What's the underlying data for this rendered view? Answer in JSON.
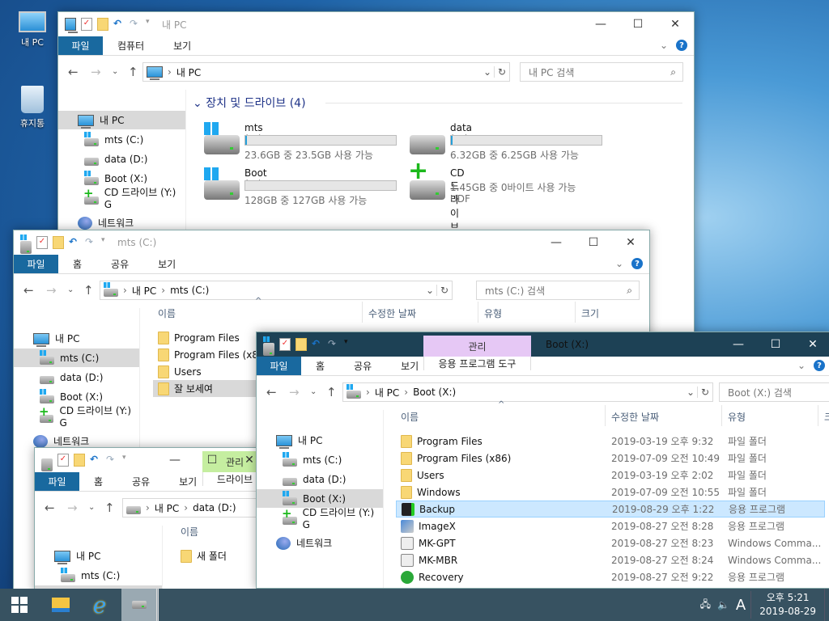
{
  "desktop": {
    "icons": [
      {
        "label": "내 PC",
        "icon": "pc-icon"
      },
      {
        "label": "휴지통",
        "icon": "recycle-bin-icon"
      }
    ]
  },
  "colors": {
    "ribbon_file_tab": "#19699f",
    "active_titlebar": "#1d4155",
    "manage_tab_app": "#e6c8f5",
    "manage_tab_drive": "#c5eea0",
    "taskbar": "#375261",
    "selection": "#cce8ff"
  },
  "windows": [
    {
      "id": "w1",
      "title": "내 PC",
      "active": false,
      "tabs": [
        "파일",
        "컴퓨터",
        "보기"
      ],
      "address": [
        "내 PC"
      ],
      "search_placeholder": "내 PC 검색",
      "nav": [
        {
          "label": "내 PC",
          "icon": "pc",
          "selected": true
        },
        {
          "label": "mts (C:)",
          "icon": "win"
        },
        {
          "label": "data (D:)",
          "icon": "drive"
        },
        {
          "label": "Boot (X:)",
          "icon": "win"
        },
        {
          "label": "CD 드라이브 (Y:) G",
          "icon": "cd"
        },
        {
          "label": "네트워크",
          "icon": "net"
        }
      ],
      "group_header": "장치 및 드라이브 (4)",
      "drives": [
        {
          "name": "mts (C:)",
          "info": "23.6GB 중 23.5GB 사용 가능",
          "used_fraction": 0.004,
          "icon": "windows-drive"
        },
        {
          "name": "data (D:)",
          "info": "6.32GB 중 6.25GB 사용 가능",
          "used_fraction": 0.011,
          "icon": "drive"
        },
        {
          "name": "Boot (X:)",
          "info": "128GB 중 127GB 사용 가능",
          "used_fraction": 0.0,
          "icon": "windows-drive"
        },
        {
          "name": "CD 드라이브 (Y:) GRJ",
          "info": "1.45GB 중 0바이트 사용 가능",
          "info2": "UDF",
          "icon": "cd-drive"
        }
      ]
    },
    {
      "id": "w2",
      "title": "mts (C:)",
      "active": false,
      "tabs": [
        "파일",
        "홈",
        "공유",
        "보기"
      ],
      "address": [
        "내 PC",
        "mts (C:)"
      ],
      "search_placeholder": "mts (C:) 검색",
      "columns": [
        "이름",
        "수정한 날짜",
        "유형",
        "크기"
      ],
      "nav": [
        {
          "label": "내 PC",
          "icon": "pc"
        },
        {
          "label": "mts (C:)",
          "icon": "win",
          "selected": true
        },
        {
          "label": "data (D:)",
          "icon": "drive"
        },
        {
          "label": "Boot (X:)",
          "icon": "win"
        },
        {
          "label": "CD 드라이브 (Y:) G",
          "icon": "cd"
        },
        {
          "label": "네트워크",
          "icon": "net"
        }
      ],
      "files": [
        {
          "name": "Program Files",
          "icon": "folder"
        },
        {
          "name": "Program Files (x86)",
          "icon": "folder"
        },
        {
          "name": "Users",
          "icon": "folder"
        },
        {
          "name": "잘 보세여",
          "icon": "folder",
          "hover": true
        }
      ]
    },
    {
      "id": "w4",
      "title": "",
      "active": false,
      "context_tab": "관리",
      "context_sub": "드라이브",
      "tabs": [
        "파일",
        "홈",
        "공유",
        "보기"
      ],
      "address": [
        "내 PC",
        "data (D:)"
      ],
      "columns": [
        "이름"
      ],
      "nav": [
        {
          "label": "내 PC",
          "icon": "pc"
        },
        {
          "label": "mts (C:)",
          "icon": "win"
        },
        {
          "label": "data (D:)",
          "icon": "drive",
          "selected": true
        }
      ],
      "files": [
        {
          "name": "새 폴더",
          "icon": "folder"
        }
      ]
    },
    {
      "id": "w3",
      "title": "Boot (X:)",
      "active": true,
      "context_tab": "관리",
      "context_sub": "응용 프로그램 도구",
      "tabs": [
        "파일",
        "홈",
        "공유",
        "보기"
      ],
      "address": [
        "내 PC",
        "Boot (X:)"
      ],
      "search_placeholder": "Boot (X:) 검색",
      "columns": [
        "이름",
        "수정한 날짜",
        "유형",
        "크"
      ],
      "nav": [
        {
          "label": "내 PC",
          "icon": "pc"
        },
        {
          "label": "mts (C:)",
          "icon": "win"
        },
        {
          "label": "data (D:)",
          "icon": "drive"
        },
        {
          "label": "Boot (X:)",
          "icon": "win",
          "selected": true
        },
        {
          "label": "CD 드라이브 (Y:) G",
          "icon": "cd"
        },
        {
          "label": "네트워크",
          "icon": "net"
        }
      ],
      "files": [
        {
          "name": "Program Files",
          "date": "2019-03-19 오후 9:32",
          "type": "파일 폴더",
          "icon": "folder"
        },
        {
          "name": "Program Files (x86)",
          "date": "2019-07-09 오전 10:49",
          "type": "파일 폴더",
          "icon": "folder"
        },
        {
          "name": "Users",
          "date": "2019-03-19 오후 2:02",
          "type": "파일 폴더",
          "icon": "folder"
        },
        {
          "name": "Windows",
          "date": "2019-07-09 오전 10:55",
          "type": "파일 폴더",
          "icon": "folder"
        },
        {
          "name": "Backup",
          "date": "2019-08-29 오후 1:22",
          "type": "응용 프로그램",
          "icon": "backup",
          "selected": true
        },
        {
          "name": "ImageX",
          "date": "2019-08-27 오전 8:28",
          "type": "응용 프로그램",
          "icon": "imagex"
        },
        {
          "name": "MK-GPT",
          "date": "2019-08-27 오전 8:23",
          "type": "Windows Comma...",
          "icon": "cmd"
        },
        {
          "name": "MK-MBR",
          "date": "2019-08-27 오전 8:24",
          "type": "Windows Comma...",
          "icon": "cmd"
        },
        {
          "name": "Recovery",
          "date": "2019-08-27 오전 9:22",
          "type": "응용 프로그램",
          "icon": "recovery"
        }
      ]
    }
  ],
  "taskbar": {
    "items": [
      "start-icon",
      "file-explorer-icon",
      "internet-explorer-icon",
      "drive-window-icon"
    ],
    "ime": "A",
    "time": "오후 5:21",
    "date": "2019-08-29"
  }
}
